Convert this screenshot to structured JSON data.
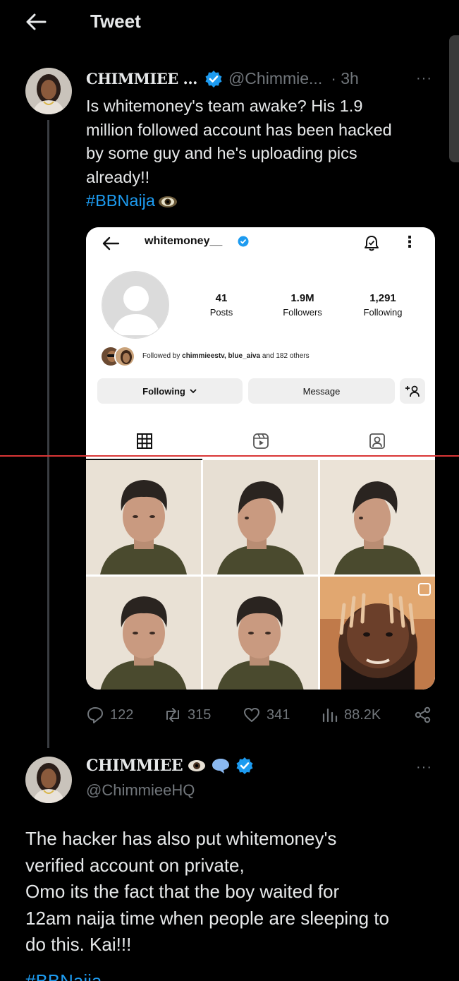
{
  "header": {
    "title": "Tweet",
    "back_icon": "arrow-left-icon"
  },
  "tweet1": {
    "author_name": "CHIMMIEE ...",
    "handle": "@Chimmie...",
    "time": "· 3h",
    "more": "···",
    "text_lines": [
      "Is whitemoney's team awake? His 1.9",
      "million followed account has been hacked",
      "by some guy and he's uploading pics",
      "already!!"
    ],
    "hashtag": "#BBNaija",
    "media": {
      "username": "whitemoney__",
      "posts_count": "41",
      "posts_label": "Posts",
      "followers_count": "1.9M",
      "followers_label": "Followers",
      "following_count": "1,291",
      "following_label": "Following",
      "followed_by_prefix": "Followed by ",
      "followed_by_names": "chimmieestv, blue_aiva",
      "followed_by_suffix": " and 182 others",
      "following_button": "Following",
      "message_button": "Message",
      "kebab": "⋮"
    },
    "actions": {
      "replies": "122",
      "retweets": "315",
      "likes": "341",
      "views": "88.2K"
    }
  },
  "tweet2": {
    "author_name": "CHIMMIEE",
    "handle": "@ChimmieeHQ",
    "more": "···",
    "text_lines": [
      "The hacker has also put whitemoney's",
      "verified account on private,",
      "Omo its the fact that the boy waited for",
      "12am naija time when people are sleeping to",
      "do this. Kai!!!"
    ],
    "hashtag": "#BBNaija"
  },
  "colors": {
    "accent": "#1d9bf0",
    "muted": "#71767b",
    "background": "#000000",
    "divider": "#d93636"
  }
}
